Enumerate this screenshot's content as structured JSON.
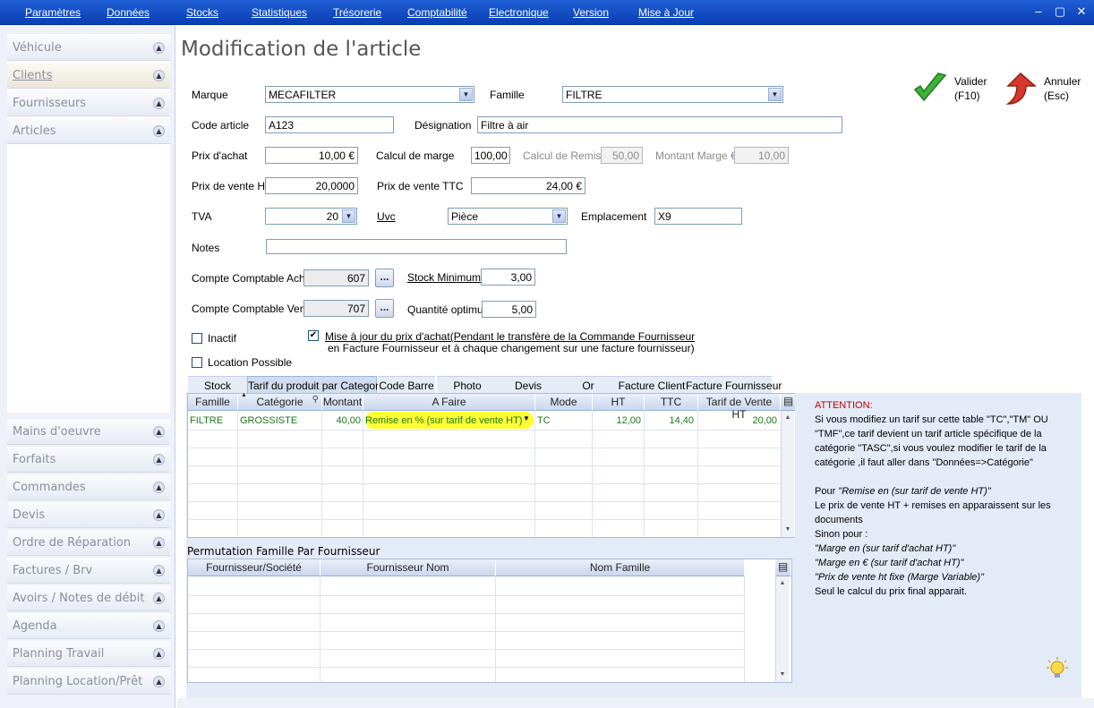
{
  "menu": [
    "Paramètres",
    "Données",
    "Stocks",
    "Statistiques",
    "Trésorerie",
    "Comptabilité",
    "Electronique",
    "Version",
    "Mise à Jour"
  ],
  "sidebar_top": [
    "Véhicule",
    "Clients",
    "Fournisseurs",
    "Articles"
  ],
  "sidebar_bottom": [
    "Mains d'oeuvre",
    "Forfaits",
    "Commandes",
    "Devis",
    "Ordre de Réparation",
    "Factures / Brv",
    "Avoirs / Notes de débit",
    "Agenda",
    "Planning Travail",
    "Planning Location/Prêt"
  ],
  "title": "Modification de l'article",
  "actions": {
    "validate_line1": "Valider",
    "validate_line2": "(F10)",
    "cancel_line1": "Annuler",
    "cancel_line2": "(Esc)"
  },
  "form": {
    "marque_label": "Marque",
    "marque": "MECAFILTER",
    "famille_label": "Famille",
    "famille": "FILTRE",
    "code_label": "Code article",
    "code": "A123",
    "designation_label": "Désignation",
    "designation": "Filtre à air",
    "prix_achat_label": "Prix d'achat",
    "prix_achat": "10,00 €",
    "calcul_marge_label": "Calcul de marge",
    "calcul_marge": "100,00",
    "calcul_remise_label": "Calcul de Remise",
    "calcul_remise": "50,00",
    "montant_marge_label": "Montant Marge €",
    "montant_marge": "10,00",
    "pv_ht_label": "Prix de vente HT",
    "pv_ht": "20,0000",
    "pv_ttc_label": "Prix de vente TTC",
    "pv_ttc": "24,00 €",
    "tva_label": "TVA",
    "tva": "20",
    "uvc_label": "Uvc",
    "uvc": "Pièce",
    "emplacement_label": "Emplacement",
    "emplacement": "X9",
    "notes_label": "Notes",
    "notes": "",
    "cc_achat_label": "Compte Comptable Achat",
    "cc_achat": "607",
    "cc_vente_label": "Compte Comptable Vente",
    "cc_vente": "707",
    "stock_min_label": "Stock Minimum",
    "stock_min": "3,00",
    "qte_opt_label": "Quantité optimum",
    "qte_opt": "5,00",
    "inactif_label": "Inactif",
    "location_label": "Location Possible",
    "maj_label1": "Mise à jour du prix d'achat(Pendant le transfère de la Commande Fournisseur",
    "maj_label2": "en Facture Fournisseur et à chaque changement sur une facture fournisseur)",
    "dots": "..."
  },
  "tabs": [
    "Stock",
    "Tarif du produit par Categorie",
    "Code Barre",
    "Photo",
    "Devis",
    "Or",
    "Facture Client",
    "Facture Fournisseur"
  ],
  "tarif_grid": {
    "headers": [
      "Famille",
      "Catégorie",
      "Montant",
      "A Faire",
      "Mode",
      "HT",
      "TTC",
      "Tarif de Vente HT"
    ],
    "row": [
      "FILTRE",
      "GROSSISTE",
      "40,00",
      "Remise en % (sur tarif de vente HT)",
      "TC",
      "12,00",
      "14,40",
      "20,00"
    ]
  },
  "permutation": {
    "title": "Permutation Famille Par Fournisseur",
    "headers": [
      "Fournisseur/Société",
      "Fournisseur Nom",
      "Nom Famille"
    ]
  },
  "info": {
    "attention": "ATTENTION:",
    "p1": "Si vous modifiez un tarif sur cette table \"TC\",\"TM\" OU \"TMF\",ce tarif devient un tarif article spécifique de la catégorie \"TASC\",si vous voulez modifier le tarif de la catégorie ,il faut aller dans \"Données=>Catégorie\"",
    "p2a": "Pour ",
    "p2b": "\"Remise en (sur tarif de vente HT)\"",
    "p3": "Le prix de vente HT + remises en apparaissent sur les documents",
    "p4": "Sinon pour :",
    "p5": "\"Marge en (sur tarif d'achat HT)\"",
    "p6": "\"Marge en € (sur tarif d'achat HT)\"",
    "p7": "\"Prix de vente ht fixe (Marge Variable)\"",
    "p8": "Seul le calcul du prix final apparait."
  },
  "colors": {
    "menubar": "#0a3fb3",
    "highlight": "#ffff33",
    "grid_text": "#1a7a1a",
    "warning": "#c00000"
  }
}
